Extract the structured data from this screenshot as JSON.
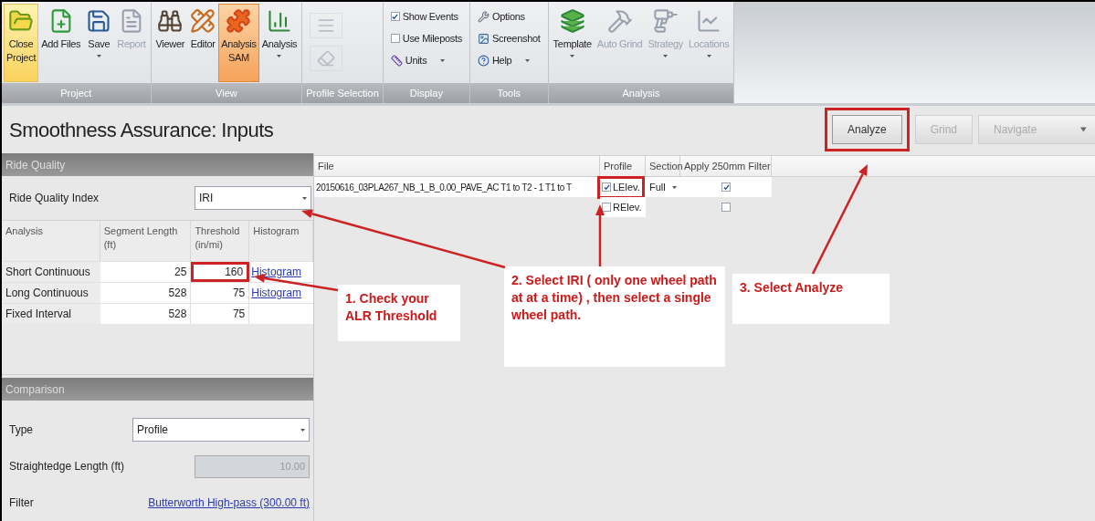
{
  "ribbon": {
    "groups": [
      {
        "label": "Project",
        "items": [
          {
            "kind": "large",
            "label": "Close\nProject",
            "dropdown": false,
            "hovered": true,
            "selected": false,
            "disabled": false
          },
          {
            "kind": "large",
            "label": "Add Files",
            "dropdown": false,
            "hovered": false,
            "selected": false,
            "disabled": false
          },
          {
            "kind": "large",
            "label": "Save",
            "dropdown": true,
            "hovered": false,
            "selected": false,
            "disabled": false
          },
          {
            "kind": "large",
            "label": "Report",
            "dropdown": false,
            "hovered": false,
            "selected": false,
            "disabled": true
          }
        ]
      },
      {
        "label": "View",
        "items": [
          {
            "kind": "large",
            "label": "Viewer",
            "dropdown": false,
            "hovered": false,
            "selected": false,
            "disabled": false
          },
          {
            "kind": "large",
            "label": "Editor",
            "dropdown": false,
            "hovered": false,
            "selected": false,
            "disabled": false
          },
          {
            "kind": "large",
            "label": "Analysis\nSAM",
            "dropdown": false,
            "hovered": false,
            "selected": true,
            "disabled": false
          },
          {
            "kind": "large",
            "label": "Analysis",
            "dropdown": true,
            "hovered": false,
            "selected": false,
            "disabled": false
          }
        ]
      },
      {
        "label": "Profile Selection",
        "items": [
          {
            "kind": "icon",
            "disabled": true
          },
          {
            "kind": "icon",
            "disabled": true
          }
        ]
      },
      {
        "label": "Display",
        "items": [
          {
            "kind": "check",
            "label": "Show Events",
            "checked": true
          },
          {
            "kind": "check",
            "label": "Use Mileposts",
            "checked": false
          },
          {
            "kind": "small",
            "label": "Units",
            "dropdown": true,
            "disabled": false
          }
        ]
      },
      {
        "label": "Tools",
        "items": [
          {
            "kind": "small",
            "label": "Options",
            "dropdown": false,
            "disabled": false
          },
          {
            "kind": "small",
            "label": "Screenshot",
            "dropdown": false,
            "disabled": false
          },
          {
            "kind": "small",
            "label": "Help",
            "dropdown": true,
            "disabled": false
          }
        ]
      },
      {
        "label": "Analysis",
        "items": [
          {
            "kind": "large",
            "label": "Template",
            "dropdown": true,
            "hovered": false,
            "selected": false,
            "disabled": false
          },
          {
            "kind": "large",
            "label": "Auto Grind",
            "dropdown": false,
            "hovered": false,
            "selected": false,
            "disabled": true
          },
          {
            "kind": "large",
            "label": "Strategy",
            "dropdown": true,
            "hovered": false,
            "selected": false,
            "disabled": true
          },
          {
            "kind": "large",
            "label": "Locations",
            "dropdown": true,
            "hovered": false,
            "selected": false,
            "disabled": true
          }
        ]
      }
    ]
  },
  "title": "Smoothness Assurance: Inputs",
  "actions": [
    {
      "label": "Analyze",
      "disabled": false,
      "highlighted": true,
      "dropdown": false
    },
    {
      "label": "Grind",
      "disabled": true,
      "highlighted": false,
      "dropdown": false
    },
    {
      "label": "Navigate",
      "disabled": true,
      "highlighted": false,
      "dropdown": true
    }
  ],
  "ride_quality": {
    "title": "Ride Quality",
    "index_label": "Ride Quality Index",
    "index_value": "IRI",
    "columns": [
      "Analysis",
      "Segment Length\n(ft)",
      "Threshold\n(in/mi)",
      "Histogram"
    ],
    "rows": [
      {
        "analysis": "Short Continuous",
        "segment_length": "25",
        "threshold": "160",
        "threshold_highlighted": true,
        "histogram": "Histogram"
      },
      {
        "analysis": "Long Continuous",
        "segment_length": "528",
        "threshold": "75",
        "threshold_highlighted": false,
        "histogram": "Histogram"
      },
      {
        "analysis": "Fixed Interval",
        "segment_length": "528",
        "threshold": "75",
        "threshold_highlighted": false
      }
    ]
  },
  "comparison": {
    "title": "Comparison",
    "type_label": "Type",
    "type_value": "Profile",
    "straightedge_label": "Straightedge Length (ft)",
    "straightedge_value": "10.00",
    "straightedge_disabled": true,
    "filter_label": "Filter",
    "filter_value": "Butterworth High-pass (300.00 ft)"
  },
  "files": {
    "columns": [
      "File",
      "Profile",
      "Section",
      "Apply 250mm Filter"
    ],
    "rows": [
      {
        "file": "20150616_03PLA267_NB_1_B_0.00_PAVE_AC T1 to T2 - 1 T1 to T",
        "profile": "LElev.",
        "profile_checked": true,
        "profile_highlighted": true,
        "section": "Full",
        "filter_checked": true
      },
      {
        "profile": "RElev.",
        "profile_checked": false,
        "profile_highlighted": false,
        "filter_checked": false
      }
    ]
  },
  "annotations": [
    {
      "text": "1. Check your ALR Threshold"
    },
    {
      "text": "2. Select IRI  ( only one wheel path at at a time)  , then select a single wheel path."
    },
    {
      "text": "3. Select Analyze"
    }
  ]
}
